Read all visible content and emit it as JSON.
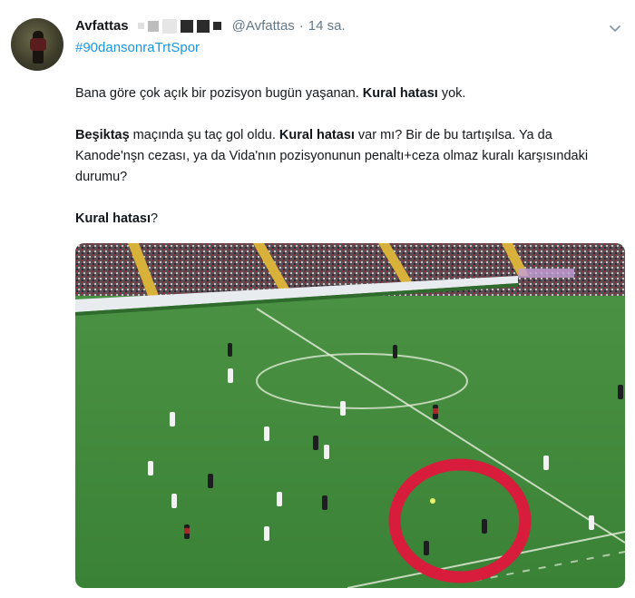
{
  "tweet": {
    "display_name": "Avfattas",
    "handle": "@Avfattas",
    "separator": "·",
    "timestamp": "14 sa.",
    "hashtag": "#90dansonraTrtSpor",
    "line1": {
      "plain1": "Bana göre çok açık bir pozisyon bugün yaşanan. ",
      "bold1": "Kural hatası",
      "plain2": " yok."
    },
    "line2": {
      "bold1": "Beşiktaş",
      "plain1": " maçında şu taç gol oldu. ",
      "bold2": "Kural hatası",
      "plain2": " var mı? Bir de bu tartışılsa. Ya da Kanode'nşn cezası, ya da Vida'nın  pozisyonunun penaltı+ceza olmaz kuralı karşısındaki durumu?"
    },
    "line3": {
      "bold1": "Kural hatası",
      "plain1": "?"
    }
  },
  "icons": {
    "more": "chevron-down-icon"
  },
  "colors": {
    "link": "#1b95e0",
    "meta": "#657786",
    "pitch": "#3f8a3a",
    "circle": "#d81c3b"
  }
}
